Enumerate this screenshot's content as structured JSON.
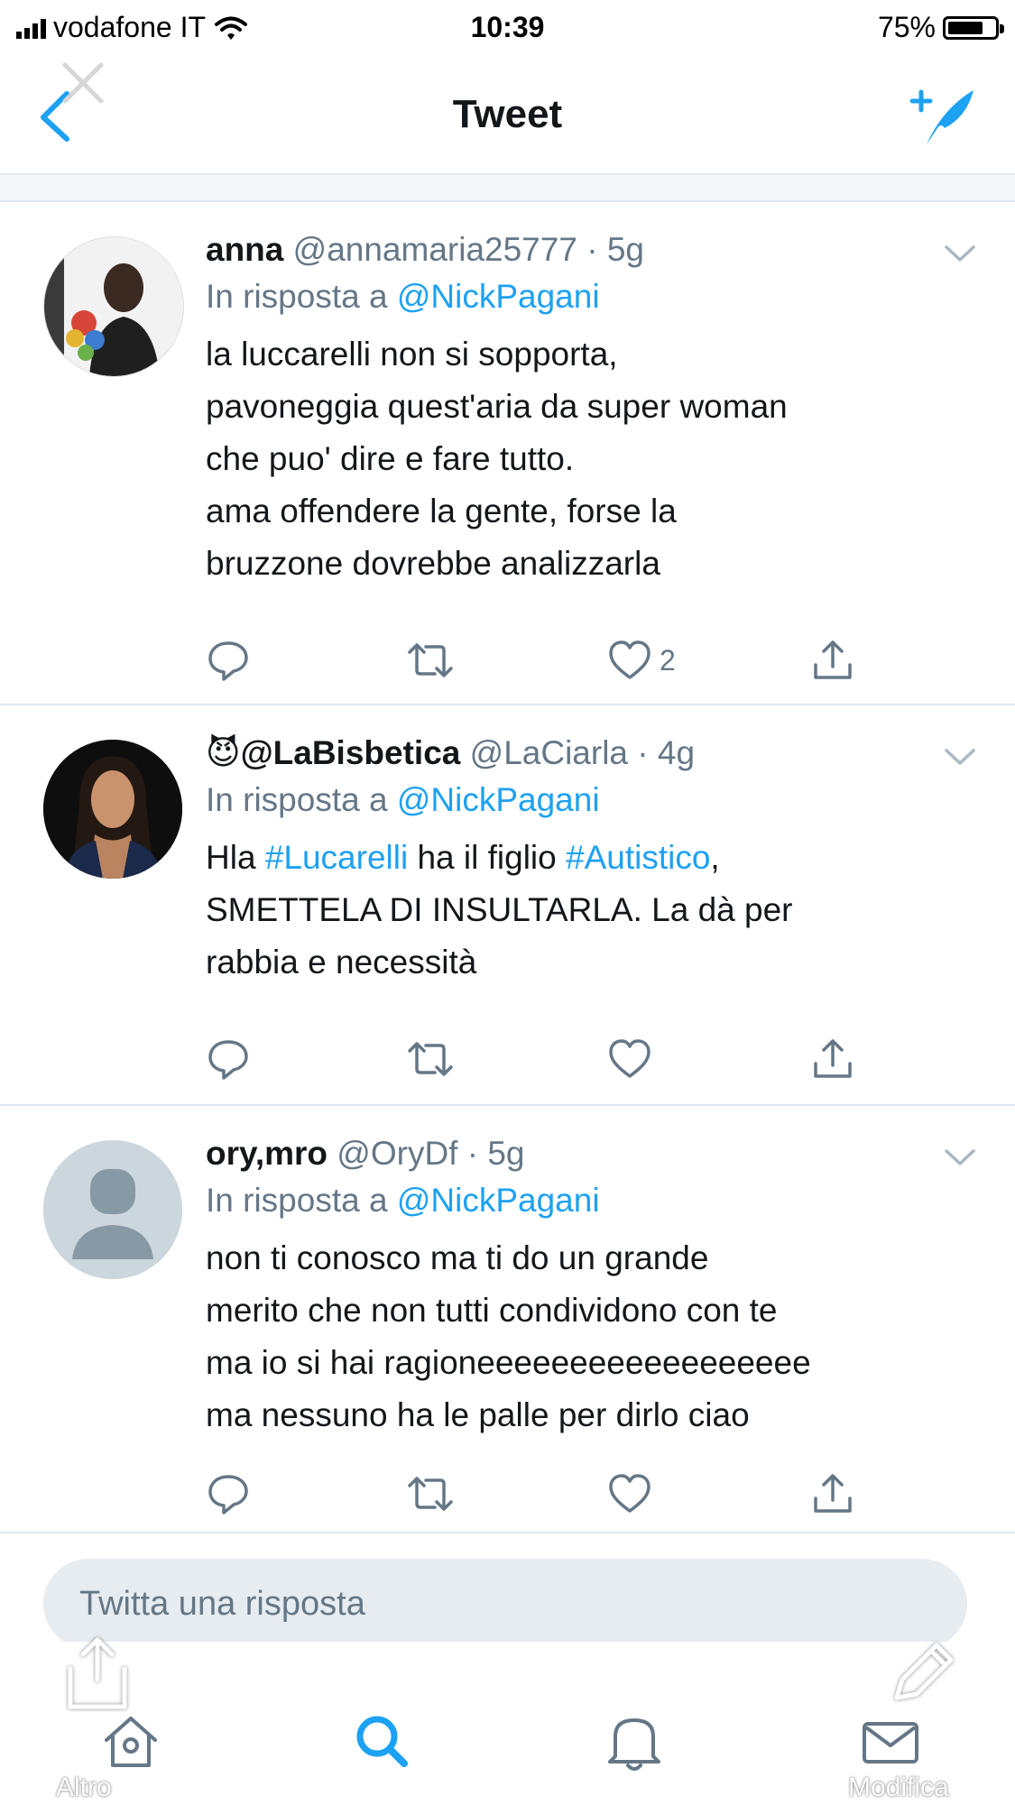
{
  "status_bar": {
    "carrier": "vodafone IT",
    "time": "10:39",
    "battery": "75%",
    "battery_level": 0.75
  },
  "nav": {
    "title": "Tweet",
    "back_icon": "chevron-left-icon",
    "compose_icon": "compose-tweet-icon"
  },
  "tweets": [
    {
      "name": "anna",
      "handle": "@annamaria25777",
      "sep": "·",
      "time": "5g",
      "reply_prefix": "In risposta a",
      "reply_mention": "@NickPagani",
      "lines": [
        "la luccarelli non si sopporta,",
        "pavoneggia quest'aria da super woman",
        "che puo' dire e fare tutto.",
        "ama offendere la gente, forse la",
        "bruzzone dovrebbe analizzarla"
      ],
      "likes": "2"
    },
    {
      "name_emoji": "😈",
      "name": "@LaBisbetica",
      "handle": "@LaCiarla",
      "sep": "·",
      "time": "4g",
      "reply_prefix": "In risposta a",
      "reply_mention": "@NickPagani",
      "line1_a": "Hla ",
      "line1_tag1": "#Lucarelli",
      "line1_b": " ha il figlio ",
      "line1_tag2": "#Autistico",
      "line1_c": ",",
      "line2": "SMETTELA DI INSULTARLA. La dà per",
      "line3": "rabbia e necessità",
      "likes": ""
    },
    {
      "name": "ory,mro",
      "handle": "@OryDf",
      "sep": "·",
      "time": "5g",
      "reply_prefix": "In risposta a",
      "reply_mention": "@NickPagani",
      "lines": [
        "non ti conosco ma ti do un grande",
        "merito che non tutti condividono con te",
        "ma io si hai ragioneeeeeeeeeeeeeeeeee",
        "ma nessuno ha le palle per dirlo ciao"
      ],
      "likes": ""
    }
  ],
  "reply_box": {
    "placeholder": "Twitta una risposta"
  },
  "tab_bar": {
    "items": [
      "home-icon",
      "search-icon",
      "notifications-icon",
      "messages-icon"
    ]
  },
  "overlay": {
    "left_label": "Altro",
    "right_label": "Modifica"
  },
  "colors": {
    "accent": "#1da1f2",
    "secondary_text": "#657786",
    "primary_text": "#14171a",
    "divider": "#e1e8ed"
  }
}
